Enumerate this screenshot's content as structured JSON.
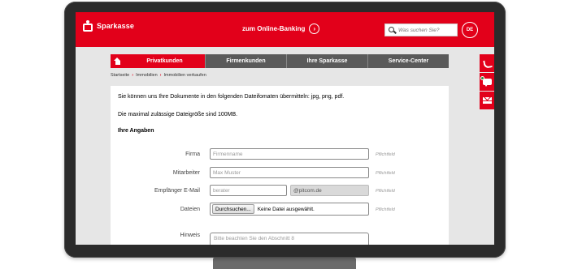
{
  "header": {
    "logo_text": "Sparkasse",
    "online_banking_label": "zum Online-Banking",
    "search_placeholder": "Was suchen Sie?",
    "language": "DE"
  },
  "nav": {
    "tabs": [
      {
        "label": "Privatkunden",
        "active": true
      },
      {
        "label": "Firmenkunden",
        "active": false
      },
      {
        "label": "Ihre Sparkasse",
        "active": false
      },
      {
        "label": "Service-Center",
        "active": false
      }
    ]
  },
  "breadcrumb": [
    "Startseite",
    "Immobilien",
    "Immobilien verkaufen"
  ],
  "content": {
    "intro": "Sie können uns Ihre Dokumente in den folgenden Dateifomaten übermitteln: jpg, png, pdf.",
    "max_size": "Die maximal zulässige Dateigröße sind 100MB.",
    "section_title": "Ihre Angaben",
    "required_label": "Pflichtfeld",
    "fields": {
      "firma": {
        "label": "Firma",
        "placeholder": "Firmenname"
      },
      "mitarbeiter": {
        "label": "Mitarbeiter",
        "placeholder": "Max Muster"
      },
      "email": {
        "label": "Empfänger E-Mail",
        "placeholder": "berater",
        "domain": "@pitcom.de"
      },
      "dateien": {
        "label": "Dateien",
        "button": "Durchsuchen...",
        "status": "Keine Datei ausgewählt."
      },
      "hinweis": {
        "label": "Hinweis",
        "placeholder": "Bitte beachten Sie den Abschnitt 8"
      }
    }
  },
  "colors": {
    "brand_red": "#e2001a",
    "nav_grey": "#5a5a5a"
  }
}
